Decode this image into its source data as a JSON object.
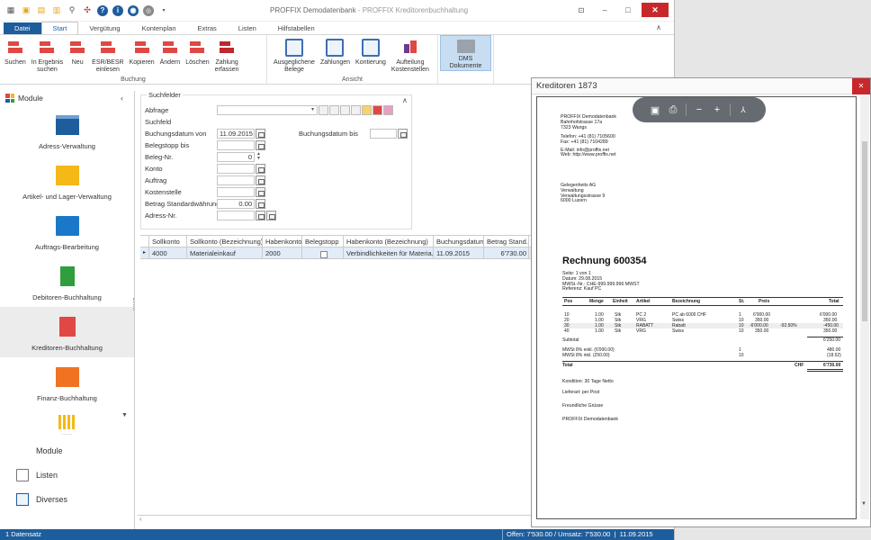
{
  "titlebar": {
    "title_main": "PROFFIX Demodatenbank",
    "title_sep": " - ",
    "title_sub": "PROFFIX Kreditorenbuchhaltung"
  },
  "tabs": [
    "Datei",
    "Start",
    "Vergütung",
    "Kontenplan",
    "Extras",
    "Listen",
    "Hilfstabellen"
  ],
  "ribbon": {
    "groups": [
      {
        "label": "Buchung",
        "buttons": [
          {
            "l1": "Suchen",
            "l2": ""
          },
          {
            "l1": "In Ergebnis",
            "l2": "suchen"
          },
          {
            "l1": "Neu",
            "l2": ""
          },
          {
            "l1": "ESR/BESR",
            "l2": "einlesen"
          },
          {
            "l1": "Kopieren",
            "l2": ""
          },
          {
            "l1": "Ändern",
            "l2": ""
          },
          {
            "l1": "Löschen",
            "l2": ""
          },
          {
            "l1": "Zahlung",
            "l2": "erfassen"
          }
        ]
      },
      {
        "label": "Ansicht",
        "buttons": [
          {
            "l1": "Ausgeglichene",
            "l2": "Belege"
          },
          {
            "l1": "Zahlungen",
            "l2": ""
          },
          {
            "l1": "Kontierung",
            "l2": ""
          },
          {
            "l1": "Aufteilung",
            "l2": "Kostenstellen"
          }
        ]
      },
      {
        "label": "",
        "buttons": [
          {
            "l1": "DMS Dokumente",
            "l2": ""
          }
        ]
      }
    ]
  },
  "sidebar": {
    "header": "Module",
    "modules": [
      {
        "label": "Adress-Verwaltung"
      },
      {
        "label": "Artikel- und Lager-Verwaltung"
      },
      {
        "label": "Auftrags-Bearbeitung"
      },
      {
        "label": "Debitoren-Buchhaltung"
      },
      {
        "label": "Kreditoren-Buchhaltung"
      },
      {
        "label": "Finanz-Buchhaltung"
      }
    ],
    "dots": "......",
    "nav": [
      {
        "label": "Module"
      },
      {
        "label": "Listen"
      },
      {
        "label": "Diverses"
      }
    ]
  },
  "search": {
    "legend": "Suchfelder",
    "abfrage": "Abfrage",
    "suchfeld": "Suchfeld",
    "buchungsdatum_von": "Buchungsdatum von",
    "buchungsdatum_von_value": "11.09.2015",
    "buchungsdatum_bis": "Buchungsdatum bis",
    "belegstopp_bis": "Belegstopp bis",
    "beleg_nr": "Beleg-Nr.",
    "beleg_nr_value": "0",
    "konto": "Konto",
    "auftrag": "Auftrag",
    "kostenstelle": "Kostenstelle",
    "betrag": "Betrag Standardwährung",
    "betrag_value": "0.00",
    "adress_nr": "Adress-Nr."
  },
  "table": {
    "headers": [
      "Sollkonto",
      "Sollkonto (Bezeichnung)",
      "Habenkonto",
      "Belegstopp",
      "Habenkonto (Bezeichnung)",
      "Buchungsdatum",
      "Betrag Stand..."
    ],
    "row": [
      "4000",
      "Materialeinkauf",
      "2000",
      "",
      "Verbindlichkeiten für Materia...",
      "11.09.2015",
      "6'730.00"
    ]
  },
  "status": {
    "left": "1 Datensatz",
    "right": "Offen: 7'530.00 / Umsatz: 7'530.00",
    "date": "11.09.2015"
  },
  "pdf": {
    "title": "Kreditoren 1873",
    "sender": [
      "PROFFIX Demodatenbank",
      "Bahnhofstrasse 17a",
      "7323 Wangs"
    ],
    "contact": [
      "Telefon: +41 (81) 7105600",
      "Fax:       +41 (81) 7104289",
      "",
      "E-Mail:  info@proffix.net",
      "Web:     http://www.proffix.net"
    ],
    "recipient": [
      "Gelegenheits AG",
      "Verwaltung",
      "Verwaltungsstrasse 9",
      "6000 Luzern"
    ],
    "heading": "Rechnung 600354",
    "meta": [
      "Seite:            1 von 1",
      "Datum:           29.08.2015",
      "MWSt.-Nr.:    CHE-999.999.996 MWST",
      "Referenz:       Kauf PC"
    ],
    "cols": [
      "Pos",
      "Menge",
      "Einheit",
      "Artikel",
      "Bezeichnung",
      "St.",
      "Preis",
      "Total"
    ],
    "rows": [
      [
        "10",
        "1.00",
        "Stk",
        "PC 2",
        "PC ab 6000 CHF",
        "1",
        "6'000.00",
        "",
        "6'000.00"
      ],
      [
        "20",
        "1.00",
        "Stk",
        "VRG",
        "Swiss",
        "10",
        "350.00",
        "",
        "350.00"
      ],
      [
        "30",
        "1.00",
        "Stk",
        "RABATT",
        "Rabatt",
        "10",
        "-6'000.00",
        "-92.50%",
        "-450.00"
      ],
      [
        "40",
        "1.00",
        "Stk",
        "VRG",
        "Swiss",
        "10",
        "350.00",
        "",
        "350.00"
      ]
    ],
    "subtotal_label": "Subtotal",
    "subtotal": "6'250.00",
    "mwst1": "MWSt 8% exkl. (6'000.00)",
    "mwst1_code": "1",
    "mwst1_value": "480.00",
    "mwst2": "MWSt 8% inkl. (250.00)",
    "mwst2_code": "10",
    "mwst2_value": "(18.52)",
    "total_label": "Total",
    "currency": "CHF",
    "total": "6'730.00",
    "kondition": "Kondition: 30 Tage Netto",
    "lieferart": "Lieferart: per Post",
    "gruss": "Freundliche Grüsse",
    "signoff": "PROFFIX Demodatenbank"
  },
  "colors": {
    "accent": "#1e5d9c",
    "close": "#c8282c",
    "selected_row": "#e1ecf8"
  }
}
